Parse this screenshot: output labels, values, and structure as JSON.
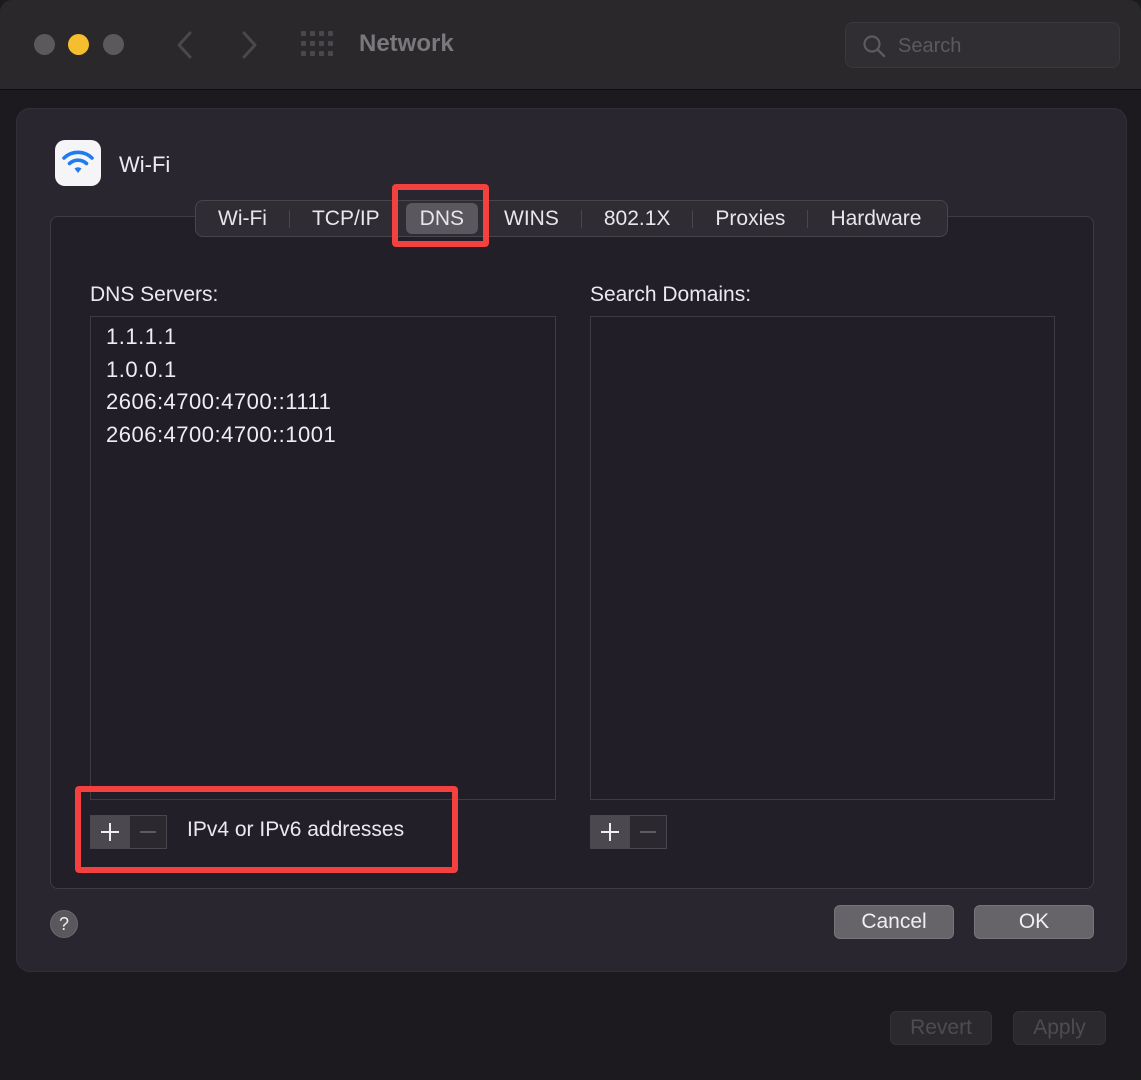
{
  "window": {
    "title": "Network",
    "search_placeholder": "Search"
  },
  "sheet": {
    "service_name": "Wi-Fi",
    "tabs": [
      {
        "label": "Wi-Fi"
      },
      {
        "label": "TCP/IP"
      },
      {
        "label": "DNS",
        "selected": true
      },
      {
        "label": "WINS"
      },
      {
        "label": "802.1X"
      },
      {
        "label": "Proxies"
      },
      {
        "label": "Hardware"
      }
    ],
    "dns_servers_label": "DNS Servers:",
    "dns_servers": [
      "1.1.1.1",
      "1.0.0.1",
      "2606:4700:4700::1111",
      "2606:4700:4700::1001"
    ],
    "search_domains_label": "Search Domains:",
    "search_domains": [],
    "add_symbol": "+",
    "remove_symbol": "−",
    "dns_hint": "IPv4 or IPv6 addresses",
    "help_symbol": "?",
    "cancel_label": "Cancel",
    "ok_label": "OK"
  },
  "footer": {
    "revert_label": "Revert",
    "apply_label": "Apply"
  },
  "colors": {
    "highlight": "#f4403f",
    "traffic_minimize": "#f5be2f",
    "wifi_icon": "#1f7cf0"
  },
  "icons": {
    "nav_back": "chevron-left-icon",
    "nav_forward": "chevron-right-icon",
    "show_all": "grid-icon",
    "search": "search-icon",
    "service": "wifi-icon"
  }
}
